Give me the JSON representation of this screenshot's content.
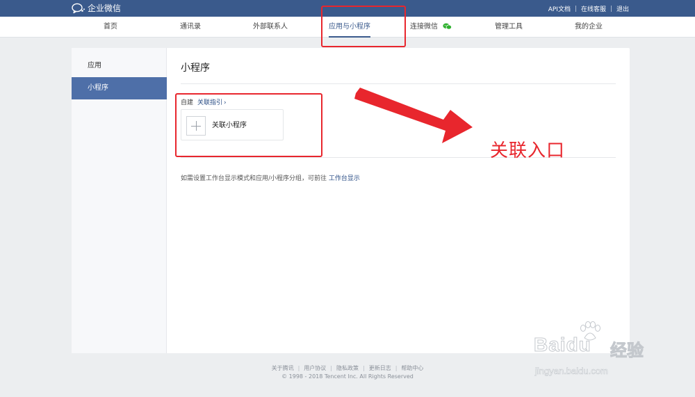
{
  "header": {
    "logo_text": "企业微信",
    "links": [
      "API文档",
      "在线客服",
      "退出"
    ]
  },
  "nav": {
    "items": [
      "首页",
      "通讯录",
      "外部联系人",
      "应用与小程序",
      "连接微信",
      "管理工具",
      "我的企业"
    ],
    "active": "应用与小程序"
  },
  "sidebar": {
    "items": [
      "应用",
      "小程序"
    ],
    "active": "小程序"
  },
  "main": {
    "title": "小程序",
    "self_build_label": "自建",
    "guide_link": "关联指引",
    "guide_chevron": "›",
    "card_label": "关联小程序",
    "hint_prefix": "如需设置工作台显示模式和应用/小程序分组，可前往",
    "hint_link": "工作台显示"
  },
  "annotation": {
    "text": "关联入口",
    "color": "#e8262d"
  },
  "footer": {
    "links": [
      "关于腾讯",
      "用户协议",
      "隐私政策",
      "更新日志",
      "帮助中心"
    ],
    "copyright": "© 1998 - 2018 Tencent Inc. All Rights Reserved"
  },
  "watermark": {
    "brand": "Baidu",
    "cn": "经验",
    "url": "jingyan.baidu.com"
  },
  "colors": {
    "header_bg": "#3a5a8c",
    "sidebar_active": "#4e6fa8",
    "link": "#2a4d85",
    "annotation_red": "#e8262d"
  },
  "icons": {
    "logo": "wecom-chat-bubble-icon",
    "wechat": "wechat-icon",
    "add": "plus-icon",
    "arrow": "red-arrow-icon"
  }
}
